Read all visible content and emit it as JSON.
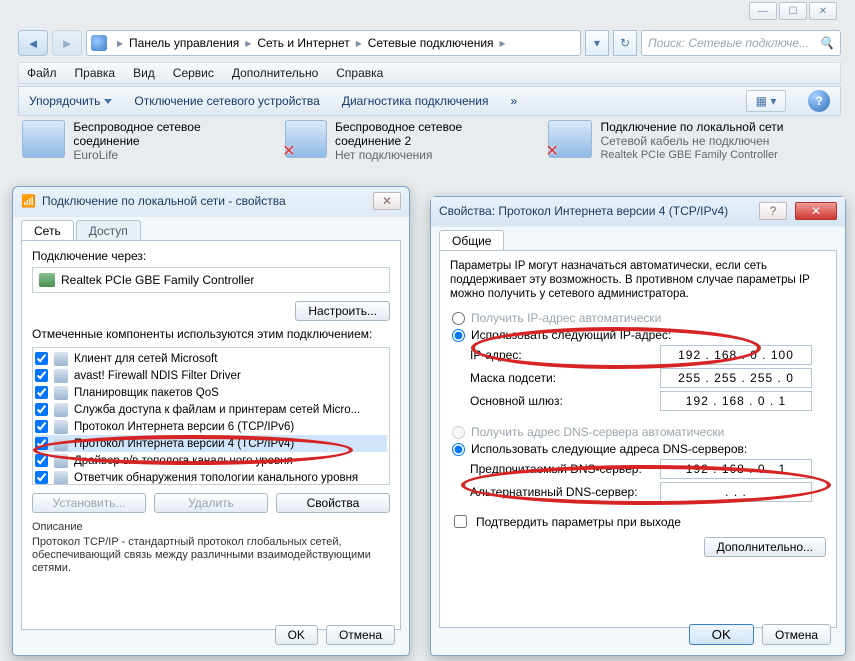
{
  "wincontrols": {
    "min": "—",
    "max": "☐",
    "close": "✕"
  },
  "breadcrumb": {
    "p1": "Панель управления",
    "p2": "Сеть и Интернет",
    "p3": "Сетевые подключения"
  },
  "search_placeholder": "Поиск: Сетевые подключе...",
  "menu": {
    "file": "Файл",
    "edit": "Правка",
    "view": "Вид",
    "service": "Сервис",
    "extra": "Дополнительно",
    "help": "Справка"
  },
  "toolbar": {
    "arrange": "Упорядочить",
    "disable": "Отключение сетевого устройства",
    "diag": "Диагностика подключения"
  },
  "connections": [
    {
      "title": "Беспроводное сетевое соединение",
      "sub1": "EuroLife",
      "sub2": ""
    },
    {
      "title": "Беспроводное сетевое соединение 2",
      "sub1": "Нет подключения",
      "sub2": ""
    },
    {
      "title": "Подключение по локальной сети",
      "sub1": "Сетевой кабель не подключен",
      "sub2": "Realtek PCIe GBE Family Controller"
    }
  ],
  "leftdlg": {
    "title": "Подключение по локальной сети - свойства",
    "tab_net": "Сеть",
    "tab_access": "Доступ",
    "conn_via": "Подключение через:",
    "adapter": "Realtek PCIe GBE Family Controller",
    "configure": "Настроить...",
    "components_label": "Отмеченные компоненты используются этим подключением:",
    "components": [
      "Клиент для сетей Microsoft",
      "avast! Firewall NDIS Filter Driver",
      "Планировщик пакетов QoS",
      "Служба доступа к файлам и принтерам сетей Micro...",
      "Протокол Интернета версии 6 (TCP/IPv6)",
      "Протокол Интернета версии 4 (TCP/IPv4)",
      "Драйвер в/в тополога канального уровня",
      "Ответчик обнаружения топологии канального уровня"
    ],
    "install": "Установить...",
    "uninstall": "Удалить",
    "props": "Свойства",
    "desc_label": "Описание",
    "desc": "Протокол TCP/IP - стандартный протокол глобальных сетей, обеспечивающий связь между различными взаимодействующими сетями.",
    "ok": "OK",
    "cancel": "Отмена"
  },
  "rightdlg": {
    "title": "Свойства: Протокол Интернета версии 4 (TCP/IPv4)",
    "tab_general": "Общие",
    "intro": "Параметры IP могут назначаться автоматически, если сеть поддерживает эту возможность. В противном случае параметры IP можно получить у сетевого администратора.",
    "r_auto_ip": "Получить IP-адрес автоматически",
    "r_man_ip": "Использовать следующий IP-адрес:",
    "f_ip": "IP-адрес:",
    "v_ip": "192 . 168 .  0  . 100",
    "f_mask": "Маска подсети:",
    "v_mask": "255 . 255 . 255 .  0",
    "f_gw": "Основной шлюз:",
    "v_gw": "192 . 168 .  0  .  1",
    "r_auto_dns": "Получить адрес DNS-сервера автоматически",
    "r_man_dns": "Использовать следующие адреса DNS-серверов:",
    "f_dns1": "Предпочитаемый DNS-сервер:",
    "v_dns1": "192 . 168 .  0  .  1",
    "f_dns2": "Альтернативный DNS-сервер:",
    "v_dns2": " .       .       . ",
    "chk_confirm": "Подтвердить параметры при выходе",
    "advanced": "Дополнительно...",
    "ok": "OK",
    "cancel": "Отмена"
  }
}
